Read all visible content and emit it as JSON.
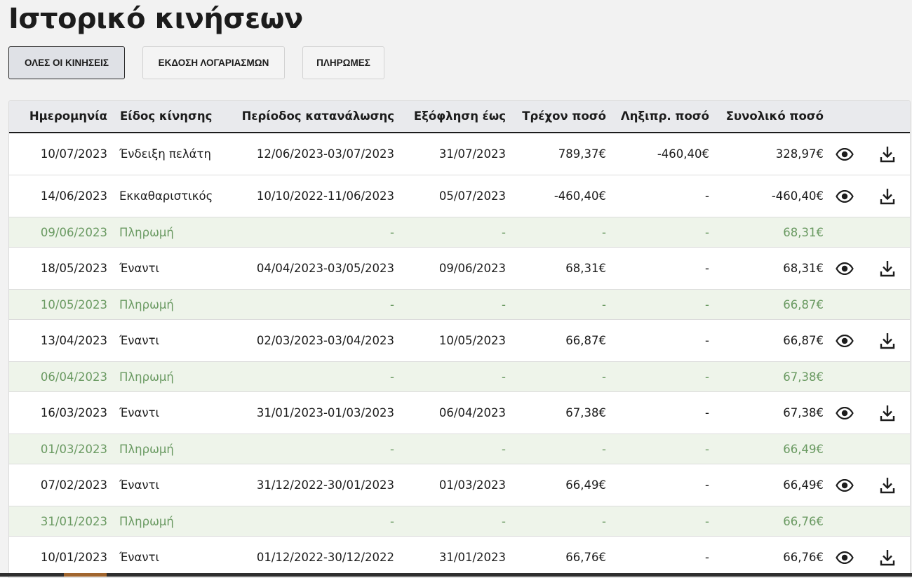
{
  "page": {
    "title": "Ιστορικό κινήσεων"
  },
  "filters": [
    {
      "label": "ΟΛΕΣ ΟΙ ΚΙΝΗΣΕΙΣ",
      "active": true
    },
    {
      "label": "ΕΚΔΟΣΗ ΛΟΓΑΡΙΑΣΜΩΝ",
      "active": false
    },
    {
      "label": "ΠΛΗΡΩΜΕΣ",
      "active": false
    }
  ],
  "table": {
    "headers": {
      "date": "Ημερομηνία",
      "type": "Είδος κίνησης",
      "period": "Περίοδος κατανάλωσης",
      "due": "Εξόφληση έως",
      "current": "Τρέχον ποσό",
      "previous": "Ληξιπρ. ποσό",
      "total": "Συνολικό ποσό"
    },
    "rows": [
      {
        "kind": "bill",
        "date": "10/07/2023",
        "type": "Ένδειξη πελάτη",
        "period": "12/06/2023-03/07/2023",
        "due": "31/07/2023",
        "current": "789,37€",
        "previous": "-460,40€",
        "total": "328,97€"
      },
      {
        "kind": "bill",
        "date": "14/06/2023",
        "type": "Εκκαθαριστικός",
        "period": "10/10/2022-11/06/2023",
        "due": "05/07/2023",
        "current": "-460,40€",
        "previous": "-",
        "total": "-460,40€"
      },
      {
        "kind": "payment",
        "date": "09/06/2023",
        "type": "Πληρωμή",
        "period": "-",
        "due": "-",
        "current": "-",
        "previous": "-",
        "total": "68,31€"
      },
      {
        "kind": "bill",
        "date": "18/05/2023",
        "type": "Έναντι",
        "period": "04/04/2023-03/05/2023",
        "due": "09/06/2023",
        "current": "68,31€",
        "previous": "-",
        "total": "68,31€"
      },
      {
        "kind": "payment",
        "date": "10/05/2023",
        "type": "Πληρωμή",
        "period": "-",
        "due": "-",
        "current": "-",
        "previous": "-",
        "total": "66,87€"
      },
      {
        "kind": "bill",
        "date": "13/04/2023",
        "type": "Έναντι",
        "period": "02/03/2023-03/04/2023",
        "due": "10/05/2023",
        "current": "66,87€",
        "previous": "-",
        "total": "66,87€"
      },
      {
        "kind": "payment",
        "date": "06/04/2023",
        "type": "Πληρωμή",
        "period": "-",
        "due": "-",
        "current": "-",
        "previous": "-",
        "total": "67,38€"
      },
      {
        "kind": "bill",
        "date": "16/03/2023",
        "type": "Έναντι",
        "period": "31/01/2023-01/03/2023",
        "due": "06/04/2023",
        "current": "67,38€",
        "previous": "-",
        "total": "67,38€"
      },
      {
        "kind": "payment",
        "date": "01/03/2023",
        "type": "Πληρωμή",
        "period": "-",
        "due": "-",
        "current": "-",
        "previous": "-",
        "total": "66,49€"
      },
      {
        "kind": "bill",
        "date": "07/02/2023",
        "type": "Έναντι",
        "period": "31/12/2022-30/01/2023",
        "due": "01/03/2023",
        "current": "66,49€",
        "previous": "-",
        "total": "66,49€"
      },
      {
        "kind": "payment",
        "date": "31/01/2023",
        "type": "Πληρωμή",
        "period": "-",
        "due": "-",
        "current": "-",
        "previous": "-",
        "total": "66,76€"
      },
      {
        "kind": "bill",
        "date": "10/01/2023",
        "type": "Έναντι",
        "period": "01/12/2022-30/12/2022",
        "due": "31/01/2023",
        "current": "66,76€",
        "previous": "-",
        "total": "66,76€"
      }
    ]
  },
  "icons": {
    "view": "eye-icon",
    "download": "download-icon"
  },
  "colors": {
    "payment_text": "#6a9a62",
    "payment_bg": "#eef4ea",
    "header_bg": "#e9eaed",
    "active_filter_bg": "#dfe1e6"
  }
}
